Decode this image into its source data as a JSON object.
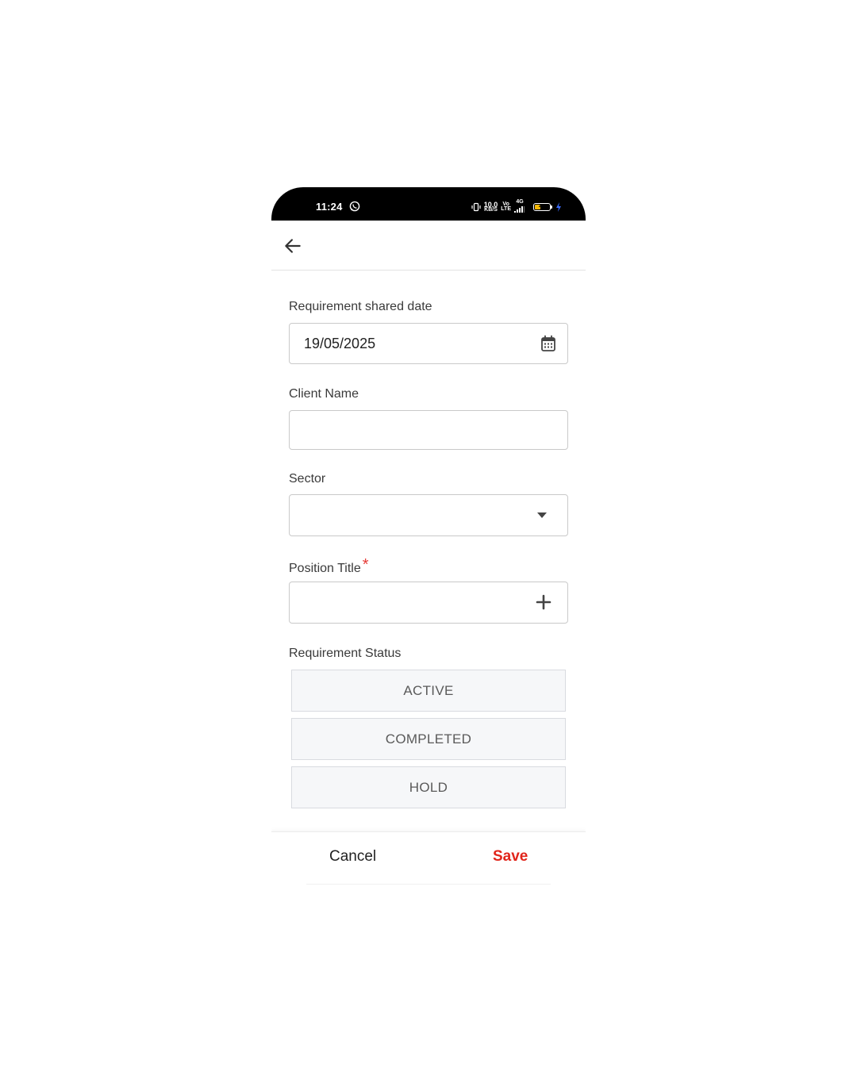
{
  "status_bar": {
    "time": "11:24",
    "net_speed_value": "10.0",
    "net_speed_unit": "KB/S",
    "volte_top": "Vo",
    "volte_bottom": "LTE",
    "network": "4G",
    "battery_level": "40",
    "battery_fraction": 0.4,
    "battery_color": "#f2b705"
  },
  "app_bar": {
    "back_icon": "arrow-left-icon"
  },
  "form": {
    "requirement_date": {
      "label": "Requirement shared date",
      "value": "19/05/2025",
      "icon": "calendar-icon"
    },
    "client_name": {
      "label": "Client Name",
      "value": ""
    },
    "sector": {
      "label": "Sector",
      "value": "",
      "icon": "dropdown-icon"
    },
    "position_title": {
      "label": "Position Title",
      "required_marker": "*",
      "value": "",
      "icon": "plus-icon"
    },
    "requirement_status": {
      "label": "Requirement Status",
      "options": [
        "ACTIVE",
        "COMPLETED",
        "HOLD"
      ]
    }
  },
  "actions": {
    "cancel_label": "Cancel",
    "save_label": "Save",
    "save_color": "#e1251b"
  }
}
